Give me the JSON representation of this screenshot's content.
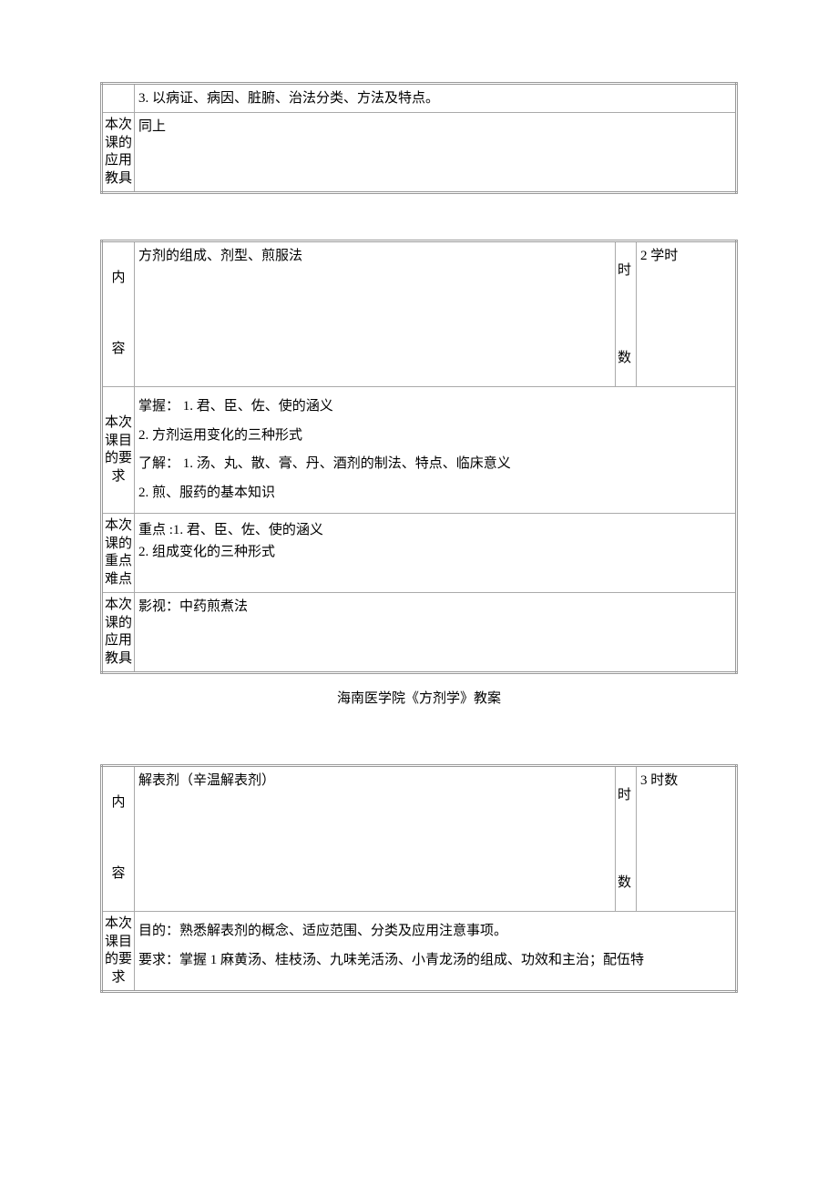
{
  "table0": {
    "prev_row_text": "3. 以病证、病因、脏腑、治法分类、方法及特点。",
    "tools_label": "本次课的应用教具",
    "tools_text": "同上"
  },
  "table1": {
    "content_label": "内\n\n\n\n容",
    "content_text": "方剂的组成、剂型、煎服法",
    "hours_label": "时\n\n\n\n数",
    "hours_value": "2 学时",
    "req_label": "本次课目的要求",
    "req_text_l1": "掌握： 1. 君、臣、佐、使的涵义",
    "req_text_l2": "2. 方剂运用变化的三种形式",
    "req_text_l3": "了解： 1. 汤、丸、散、膏、丹、酒剂的制法、特点、临床意义",
    "req_text_l4": "2. 煎、服药的基本知识",
    "focus_label": "本次课的重点难点",
    "focus_text_l1": "重点 :1. 君、臣、佐、使的涵义",
    "focus_text_l2": "2. 组成变化的三种形式",
    "tools_label": "本次课的应用教具",
    "tools_text": "影视：中药煎煮法"
  },
  "caption": "海南医学院《方剂学》教案",
  "table2": {
    "content_label": "内\n\n\n\n容",
    "content_text": "解表剂（辛温解表剂）",
    "hours_label": "时\n\n\n\n数",
    "hours_value": "3 时数",
    "req_label": "本次课目的要求",
    "req_text_l1": "目的：熟悉解表剂的概念、适应范围、分类及应用注意事项。",
    "req_text_l2": "要求：掌握 1 麻黄汤、桂枝汤、九味羌活汤、小青龙汤的组成、功效和主治；配伍特"
  }
}
